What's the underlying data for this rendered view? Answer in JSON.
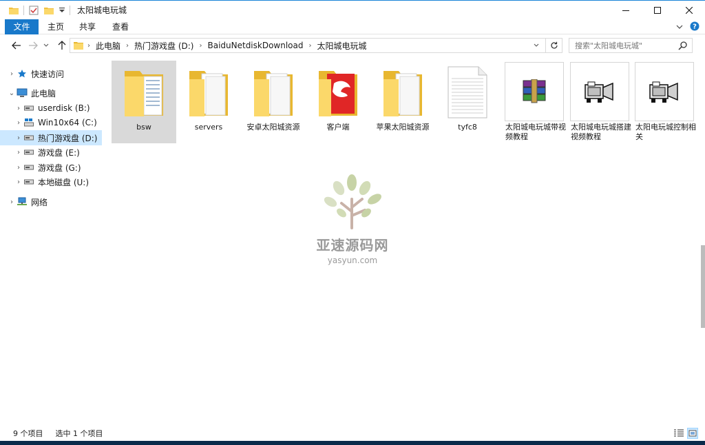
{
  "window": {
    "title": "太阳城电玩城",
    "accent": "#1979ca"
  },
  "ribbon": {
    "tabs": [
      {
        "label": "文件",
        "active": true
      },
      {
        "label": "主页"
      },
      {
        "label": "共享"
      },
      {
        "label": "查看"
      }
    ]
  },
  "address": {
    "crumbs": [
      "此电脑",
      "热门游戏盘 (D:)",
      "BaiduNetdiskDownload",
      "太阳城电玩城"
    ],
    "search_placeholder": "搜索\"太阳城电玩城\""
  },
  "nav": {
    "items": [
      {
        "label": "快速访问",
        "icon": "star-icon",
        "expanded": false,
        "level": 0
      },
      {
        "label": "此电脑",
        "icon": "computer-icon",
        "expanded": true,
        "level": 0
      },
      {
        "label": "userdisk (B:)",
        "icon": "drive-icon",
        "level": 1
      },
      {
        "label": "Win10x64 (C:)",
        "icon": "windows-drive-icon",
        "level": 1
      },
      {
        "label": "热门游戏盘 (D:)",
        "icon": "drive-icon",
        "level": 1,
        "selected": true
      },
      {
        "label": "游戏盘 (E:)",
        "icon": "drive-icon",
        "level": 1
      },
      {
        "label": "游戏盘 (G:)",
        "icon": "drive-icon",
        "level": 1
      },
      {
        "label": "本地磁盘 (U:)",
        "icon": "drive-icon",
        "level": 1
      },
      {
        "label": "网络",
        "icon": "network-icon",
        "expanded": false,
        "level": 0
      }
    ]
  },
  "files": [
    {
      "name": "bsw",
      "type": "folder",
      "selected": true
    },
    {
      "name": "servers",
      "type": "folder"
    },
    {
      "name": "安卓太阳城资源",
      "type": "folder"
    },
    {
      "name": "客户端",
      "type": "folder-red"
    },
    {
      "name": "苹果太阳城资源",
      "type": "folder"
    },
    {
      "name": "tyfc8",
      "type": "document"
    },
    {
      "name": "太阳城电玩城带视频教程",
      "type": "winrar-archive"
    },
    {
      "name": "太阳城电玩城搭建视频教程",
      "type": "video-player"
    },
    {
      "name": "太阳电玩城控制相关",
      "type": "video-player"
    }
  ],
  "watermark": {
    "title": "亚速源码网",
    "url": "yasyun.com"
  },
  "status": {
    "count": "9 个项目",
    "selected": "选中 1 个项目"
  }
}
